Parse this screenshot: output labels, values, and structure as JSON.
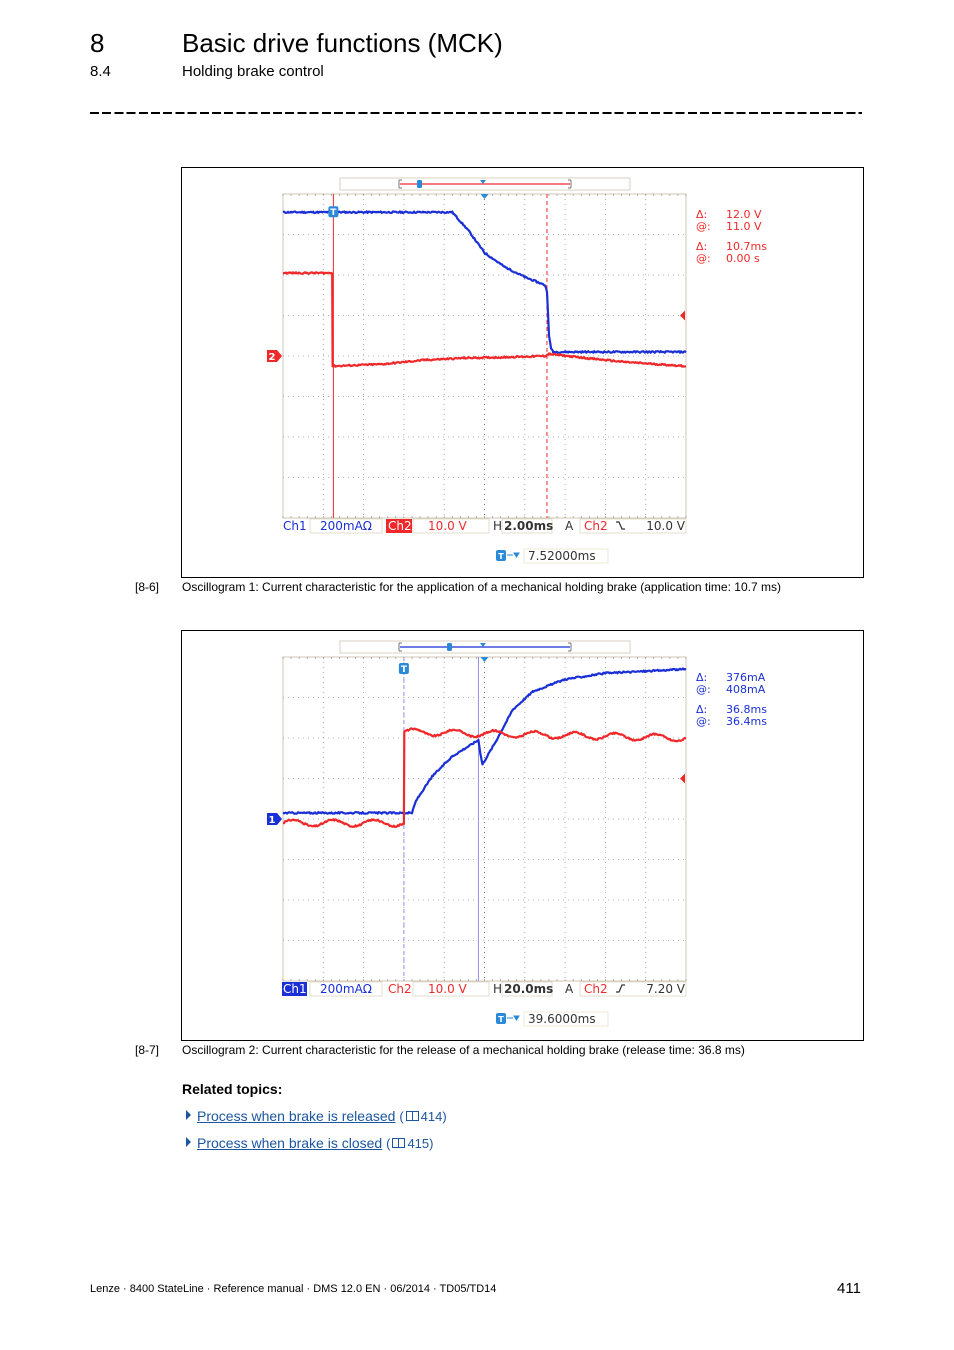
{
  "header": {
    "chapter_number": "8",
    "chapter_title": "Basic drive functions (MCK)",
    "section_number": "8.4",
    "section_title": "Holding brake control"
  },
  "colors": {
    "ch1": "#1a2fd6",
    "ch2": "#f0282a",
    "cursor_blue": "#2a8ad8",
    "link": "#1c56a0",
    "grid": "#7a7a7a"
  },
  "figures": [
    {
      "number": "[8-6]",
      "caption": "Oscillogram 1: Current characteristic for the application of a mechanical holding brake (application time: 10.7 ms)",
      "chart_data": {
        "type": "line",
        "title": "Oscillogram 1",
        "grid": true,
        "x_divisions": 10,
        "y_divisions": 8,
        "xlabel": "time (2.00 ms/div)",
        "status_bar": {
          "ch1_label": "Ch1",
          "ch1_scale": "200mAΩ",
          "ch2_label": "Ch2",
          "ch2_scale": "10.0 V",
          "timebase_label": "H",
          "timebase": "2.00ms",
          "trigger_label": "A",
          "trigger_source": "Ch2",
          "trigger_slope": "falling",
          "trigger_slope_glyph": "↘",
          "trigger_level": "10.0 V",
          "ch2_highlighted": true,
          "ch1_highlighted": false
        },
        "trigger_position_label": "7.52000ms",
        "ground_marker": "2",
        "readout": {
          "color": "ch2",
          "delta_v_label": "Δ:",
          "delta_v": "12.0 V",
          "at_v_label": "@:",
          "at_v": "11.0 V",
          "delta_t_label": "Δ:",
          "delta_t": "10.7ms",
          "at_t_label": "@:",
          "at_t": "0.00 s"
        },
        "cursors_div": {
          "t1": 1.25,
          "t2": 6.55
        },
        "series": [
          {
            "name": "Ch1 current",
            "color": "ch1",
            "x_div": [
              0,
              1.2,
              4.2,
              4.6,
              5.0,
              5.5,
              6.0,
              6.5,
              6.55,
              6.6,
              6.65,
              6.7,
              10
            ],
            "y_div": [
              7.55,
              7.55,
              7.55,
              7.1,
              6.55,
              6.2,
              5.95,
              5.75,
              5.6,
              4.5,
              4.2,
              4.1,
              4.1
            ]
          },
          {
            "name": "Ch2 voltage",
            "color": "ch2",
            "x_div": [
              0,
              1.22,
              1.23,
              2.5,
              3.5,
              4.5,
              5.5,
              6.5,
              6.6,
              7.5,
              8.5,
              10
            ],
            "y_div": [
              6.05,
              6.05,
              3.75,
              3.8,
              3.9,
              3.95,
              3.97,
              4.0,
              4.05,
              3.95,
              3.85,
              3.75
            ]
          }
        ]
      }
    },
    {
      "number": "[8-7]",
      "caption": "Oscillogram 2: Current characteristic for the release of a mechanical holding brake (release time: 36.8 ms)",
      "chart_data": {
        "type": "line",
        "title": "Oscillogram 2",
        "grid": true,
        "x_divisions": 10,
        "y_divisions": 8,
        "xlabel": "time (20.0 ms/div)",
        "status_bar": {
          "ch1_label": "Ch1",
          "ch1_scale": "200mAΩ",
          "ch2_label": "Ch2",
          "ch2_scale": "10.0 V",
          "timebase_label": "H",
          "timebase": "20.0ms",
          "trigger_label": "A",
          "trigger_source": "Ch2",
          "trigger_slope": "rising",
          "trigger_slope_glyph": "↗",
          "trigger_level": "7.20 V",
          "ch2_highlighted": false,
          "ch1_highlighted": true
        },
        "trigger_position_label": "39.6000ms",
        "ground_marker": "1",
        "readout": {
          "color": "ch1",
          "delta_v_label": "Δ:",
          "delta_v": "376mA",
          "at_v_label": "@:",
          "at_v": "408mA",
          "delta_t_label": "Δ:",
          "delta_t": "36.8ms",
          "at_t_label": "@:",
          "at_t": "36.4ms"
        },
        "cursors_div": {
          "t1": 3.0,
          "t2": 4.85
        },
        "series": [
          {
            "name": "Ch1 current",
            "color": "ch1",
            "x_div": [
              0,
              3.2,
              3.3,
              3.7,
              4.2,
              4.85,
              4.9,
              4.95,
              5.3,
              5.7,
              6.2,
              7.0,
              8.0,
              9.0,
              10
            ],
            "y_div": [
              4.15,
              4.15,
              4.45,
              5.05,
              5.55,
              5.95,
              5.6,
              5.35,
              5.95,
              6.7,
              7.15,
              7.45,
              7.6,
              7.65,
              7.7
            ]
          },
          {
            "name": "Ch2 voltage",
            "color": "ch2",
            "x_div": [
              0,
              3.0,
              3.01,
              10
            ],
            "y_div": [
              3.9,
              3.9,
              6.15,
              6.0
            ],
            "ripple_div": 0.08,
            "ripple_period_div": 1.0
          }
        ]
      }
    }
  ],
  "related": {
    "heading": "Related topics:",
    "items": [
      {
        "label": "Process when brake is released",
        "page": "414"
      },
      {
        "label": "Process when brake is closed",
        "page": "415"
      }
    ]
  },
  "footer": {
    "text": "Lenze · 8400 StateLine · Reference manual · DMS 12.0 EN · 06/2014 · TD05/TD14",
    "page_number": "411"
  }
}
